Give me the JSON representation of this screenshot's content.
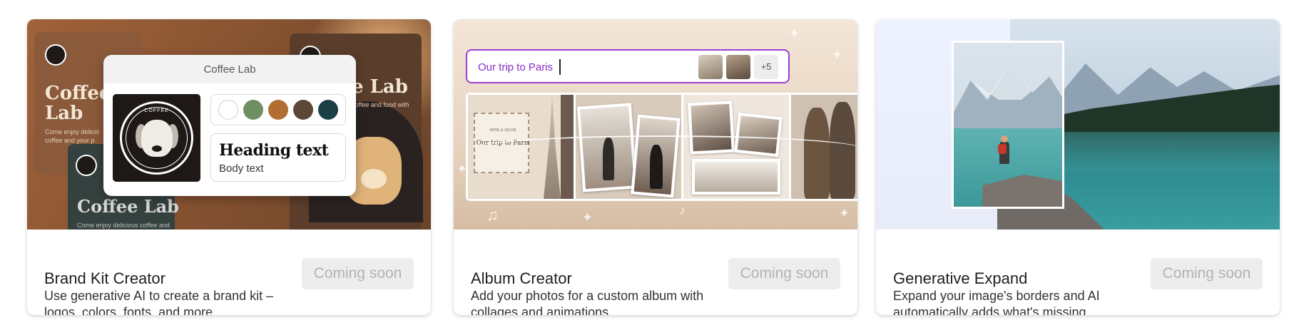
{
  "cards": [
    {
      "title": "Brand Kit Creator",
      "description": "Use generative AI to create a brand kit – logos, colors, fonts, and more.",
      "button_label": "Coming soon",
      "preview": {
        "card_title": "Coffee Lab",
        "logo_text": "COFFEE",
        "swatches": [
          "#ffffff",
          "#6f8f62",
          "#b06e32",
          "#5c4638",
          "#1a3f44"
        ],
        "heading_sample": "Heading text",
        "body_sample": "Body text",
        "bg_title_1": "Coffee Lab",
        "bg_title_2": "Coffee Lab",
        "bg_title_3": "e Lab",
        "bg_small_1": "Come enjoy delicio coffee and your p",
        "bg_small_2": "Come enjoy delicious coffee and",
        "bg_small_3": "coffee and food with"
      }
    },
    {
      "title": "Album Creator",
      "description": "Add your photos for a custom album with collages and animations.",
      "button_label": "Coming soon",
      "preview": {
        "prompt_text": "Our trip to Paris",
        "more_count": "+5",
        "note_small": "APRIL & JACOB",
        "note_text": "Our trip to Paris"
      }
    },
    {
      "title": "Generative Expand",
      "description": "Expand your image's borders and AI automatically adds what's missing.",
      "button_label": "Coming soon"
    }
  ],
  "colors": {
    "accent_purple": "#9b3fd6",
    "disabled_button_bg": "#ededed",
    "disabled_button_text": "#b3b3b3"
  }
}
